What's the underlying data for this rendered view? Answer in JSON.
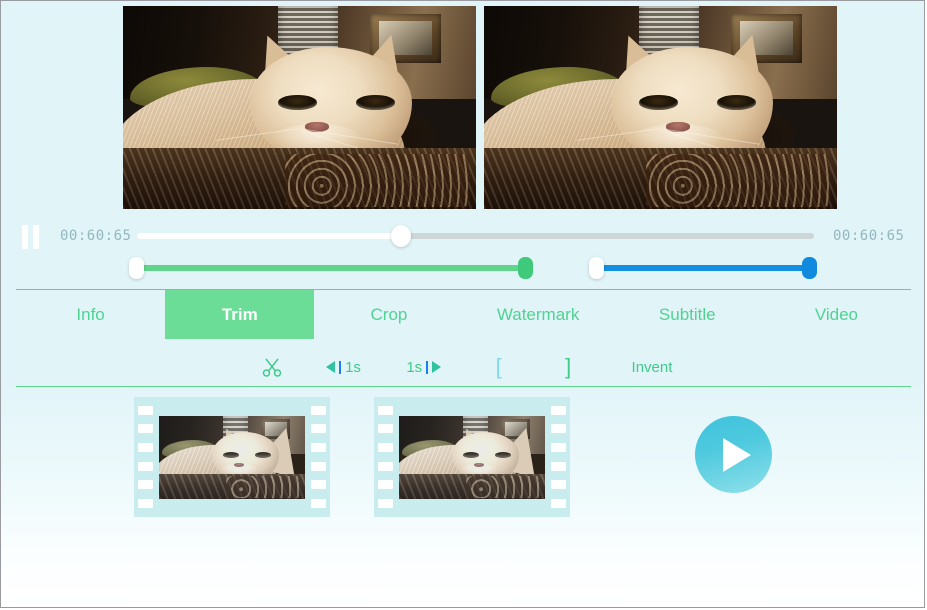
{
  "player": {
    "pause_icon": "pause-icon",
    "current_time": "00:60:65",
    "total_time": "00:60:65",
    "scrub_percent": 39
  },
  "trim_range": {
    "green": {
      "start_label": "trim-start-handle",
      "end_label": "trim-end-handle",
      "color": "#5fd48a"
    },
    "blue": {
      "start_label": "range-start-handle",
      "end_label": "range-end-handle",
      "color": "#128fe0"
    }
  },
  "tabs": [
    {
      "label": "Info",
      "name": "tab-info",
      "active": false
    },
    {
      "label": "Trim",
      "name": "tab-trim",
      "active": true
    },
    {
      "label": "Crop",
      "name": "tab-crop",
      "active": false
    },
    {
      "label": "Watermark",
      "name": "tab-watermark",
      "active": false
    },
    {
      "label": "Subtitle",
      "name": "tab-subtitle",
      "active": false
    },
    {
      "label": "Video",
      "name": "tab-video",
      "active": false
    }
  ],
  "toolbar": {
    "cut_icon": "scissors-icon",
    "cut_glyph": "✂",
    "back_label": "1s",
    "forward_label": "1s",
    "mark_in": "[",
    "mark_out": "]",
    "invent_label": "Invent"
  },
  "timeline": {
    "frames": [
      {
        "name": "filmstrip-frame-1"
      },
      {
        "name": "filmstrip-frame-2"
      }
    ],
    "play_button": "play-button"
  },
  "colors": {
    "background": "#e1f4f8",
    "accent_green": "#5fd48a",
    "accent_blue": "#128fe0",
    "accent_cyan": "#4ec9de",
    "tab_text": "#4fd392",
    "time_text": "#93b7bf"
  }
}
